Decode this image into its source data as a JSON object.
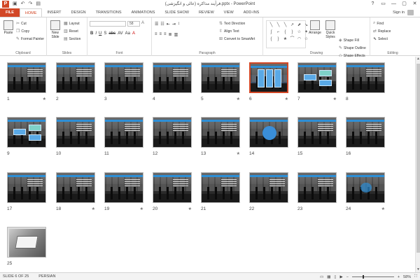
{
  "window": {
    "title": "فرآیند مذاکره (عالی و انگیزشی).pptx - PowerPoint",
    "controls": [
      "?",
      "▭",
      "—",
      "▢",
      "✕"
    ]
  },
  "qat": {
    "logo": "P",
    "save_icon": "save-icon",
    "undo_icon": "undo-icon",
    "redo_icon": "redo-icon",
    "start_icon": "start-from-beginning-icon"
  },
  "tabs": [
    "FILE",
    "HOME",
    "INSERT",
    "DESIGN",
    "TRANSITIONS",
    "ANIMATIONS",
    "SLIDE SHOW",
    "REVIEW",
    "VIEW",
    "ADD-INS"
  ],
  "active_tab": "HOME",
  "account": {
    "label": "Sign in"
  },
  "ribbon": {
    "clipboard": {
      "label": "Clipboard",
      "paste": "Paste",
      "cut": "Cut",
      "copy": "Copy",
      "format_painter": "Format Painter"
    },
    "slides": {
      "label": "Slides",
      "new_slide_line1": "New",
      "new_slide_line2": "Slide",
      "layout": "Layout",
      "reset": "Reset",
      "section": "Section"
    },
    "font": {
      "label": "Font",
      "font_name": "",
      "font_size": "58",
      "format_buttons": [
        "B",
        "I",
        "U",
        "S",
        "abc",
        "AV",
        "Aa",
        "A"
      ]
    },
    "paragraph": {
      "label": "Paragraph",
      "text_direction": "Text Direction",
      "align_text": "Align Text",
      "convert_smartart": "Convert to SmartArt"
    },
    "drawing": {
      "label": "Drawing",
      "arrange": "Arrange",
      "quick_styles_line1": "Quick",
      "quick_styles_line2": "Styles",
      "shape_fill": "Shape Fill",
      "shape_outline": "Shape Outline",
      "shape_effects": "Shape Effects",
      "shapes": [
        "╲",
        "╲",
        "╲",
        "↗",
        "⬈",
        "↘",
        "ʃ",
        "⌐",
        "{",
        "}",
        "☆",
        "✦",
        "{",
        "}",
        "★",
        "⌒",
        "◠",
        "☆"
      ]
    },
    "editing": {
      "label": "Editing",
      "find": "Find",
      "replace": "Replace",
      "select": "Select"
    }
  },
  "slides": [
    {
      "num": "1",
      "star": "★",
      "type": "title"
    },
    {
      "num": "2",
      "star": "",
      "type": "dark"
    },
    {
      "num": "3",
      "star": "",
      "type": "dark"
    },
    {
      "num": "4",
      "star": "",
      "type": "dark"
    },
    {
      "num": "5",
      "star": "★",
      "type": "dark"
    },
    {
      "num": "6",
      "star": "★",
      "type": "boxes"
    },
    {
      "num": "7",
      "star": "★",
      "type": "diagram"
    },
    {
      "num": "8",
      "star": "",
      "type": "dark"
    },
    {
      "num": "9",
      "star": "",
      "type": "diagram"
    },
    {
      "num": "10",
      "star": "",
      "type": "dark"
    },
    {
      "num": "11",
      "star": "",
      "type": "dark"
    },
    {
      "num": "12",
      "star": "",
      "type": "dark"
    },
    {
      "num": "13",
      "star": "★",
      "type": "dark"
    },
    {
      "num": "14",
      "star": "",
      "type": "circle"
    },
    {
      "num": "15",
      "star": "",
      "type": "dark"
    },
    {
      "num": "16",
      "star": "",
      "type": "dark"
    },
    {
      "num": "17",
      "star": "",
      "type": "dark"
    },
    {
      "num": "18",
      "star": "★",
      "type": "dark"
    },
    {
      "num": "19",
      "star": "★",
      "type": "dark"
    },
    {
      "num": "20",
      "star": "★",
      "type": "dark"
    },
    {
      "num": "21",
      "star": "",
      "type": "dark"
    },
    {
      "num": "22",
      "star": "",
      "type": "dark"
    },
    {
      "num": "23",
      "star": "",
      "type": "dark"
    },
    {
      "num": "24",
      "star": "★",
      "type": "end"
    },
    {
      "num": "25",
      "star": "",
      "type": "photo"
    }
  ],
  "selected_slide": "6",
  "status": {
    "slide_info": "SLIDE 6 OF 25",
    "language": "PERSIAN",
    "zoom": "58%",
    "zoom_minus": "−",
    "zoom_plus": "+"
  }
}
